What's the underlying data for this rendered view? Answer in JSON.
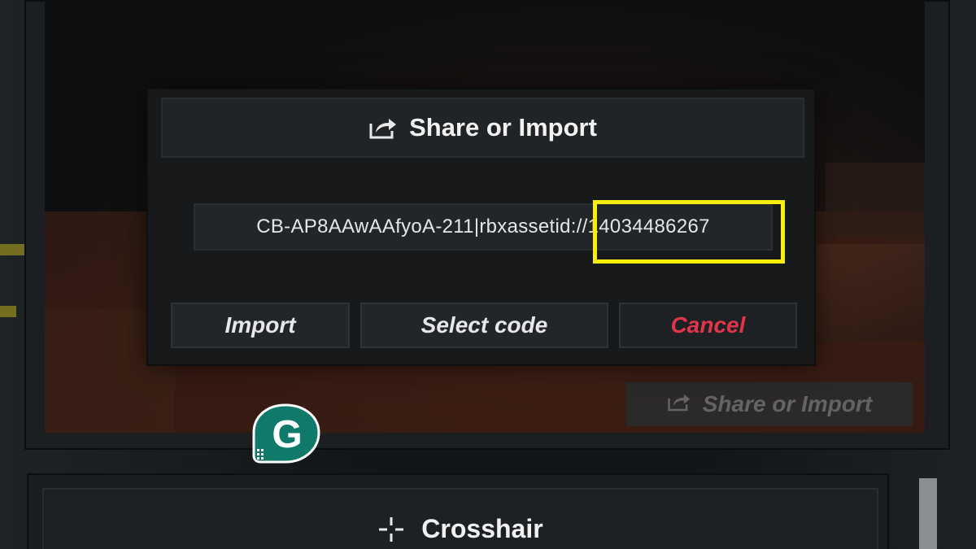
{
  "modal": {
    "title": "Share or Import",
    "title_icon": "share-icon",
    "code_value": "CB-AP8AAwAAfyoA-211|rbxassetid://14034486267",
    "buttons": {
      "import": "Import",
      "select_code": "Select code",
      "cancel": "Cancel"
    },
    "highlight_color": "#f7ee0a",
    "cancel_color": "#e0364a"
  },
  "background": {
    "share_button_label": "Share or Import",
    "share_button_icon": "share-icon"
  },
  "sections": {
    "crosshair_label": "Crosshair",
    "crosshair_icon": "crosshair-icon"
  },
  "watermark": {
    "logo_letter": "G"
  }
}
